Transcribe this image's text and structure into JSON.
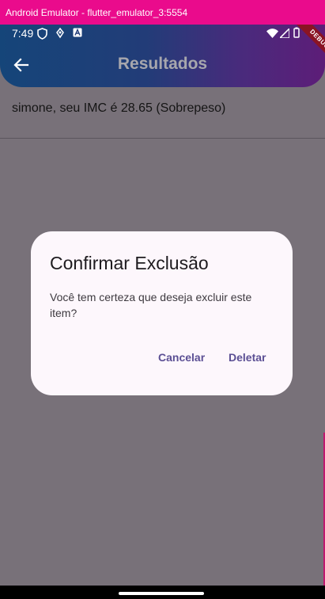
{
  "window": {
    "title": "Android Emulator - flutter_emulator_3:5554"
  },
  "status_bar": {
    "time": "7:49",
    "icons": [
      "shield-icon",
      "location-icon",
      "a-badge-icon",
      "wifi-icon",
      "signal-icon",
      "battery-icon"
    ]
  },
  "app_bar": {
    "title": "Resultados",
    "back_icon": "arrow-left-icon",
    "debug_label": "DEBUG"
  },
  "content": {
    "result_text": "simone, seu IMC é 28.65 (Sobrepeso)"
  },
  "dialog": {
    "title": "Confirmar Exclusão",
    "message": "Você tem certeza que deseja excluir este item?",
    "cancel_label": "Cancelar",
    "delete_label": "Deletar"
  },
  "colors": {
    "titlebar": "#ea0b8c",
    "appbar_start": "#154579",
    "appbar_end": "#5d1d78",
    "scrim": "#787179",
    "dialog_bg": "#fdf7fc",
    "button_text": "#5b4f94"
  }
}
